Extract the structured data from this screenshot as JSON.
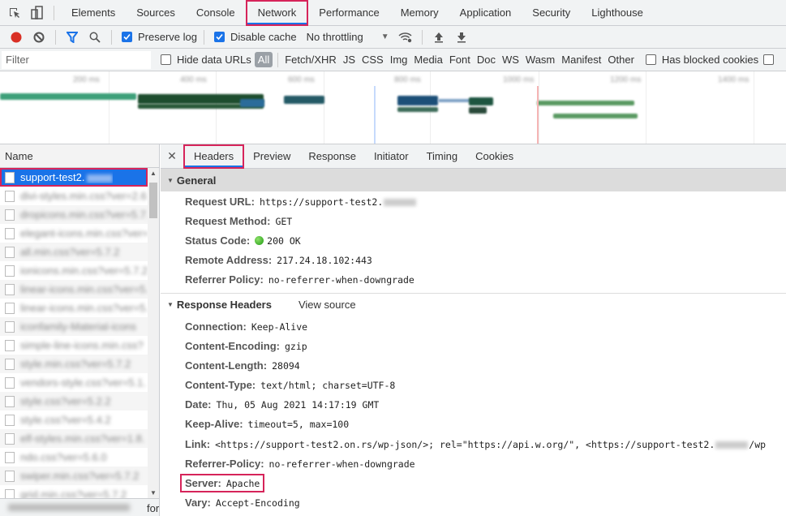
{
  "tabs": [
    "Elements",
    "Sources",
    "Console",
    "Network",
    "Performance",
    "Memory",
    "Application",
    "Security",
    "Lighthouse"
  ],
  "active_tab": "Network",
  "toolbar": {
    "preserve_log_label": "Preserve log",
    "preserve_log_checked": true,
    "disable_cache_label": "Disable cache",
    "disable_cache_checked": true,
    "throttling_value": "No throttling"
  },
  "filterbar": {
    "filter_placeholder": "Filter",
    "hide_data_urls_label": "Hide data URLs",
    "all_label": "All",
    "types": [
      "Fetch/XHR",
      "JS",
      "CSS",
      "Img",
      "Media",
      "Font",
      "Doc",
      "WS",
      "Wasm",
      "Manifest",
      "Other"
    ],
    "has_blocked_cookies_label": "Has blocked cookies"
  },
  "overview": {
    "ticks": [
      "200 ms",
      "400 ms",
      "600 ms",
      "800 ms",
      "1000 ms",
      "1200 ms",
      "1400 ms"
    ]
  },
  "request_list": {
    "header": "Name",
    "selected": "support-test2.",
    "rows": [
      "divi-styles.min.css?ver=2.6",
      "dropicons.min.css?ver=5.7.2",
      "elegant-icons.min.css?ver=5.7",
      "all.min.css?ver=5.7.2",
      "ionicons.min.css?ver=5.7.2",
      "linear-icons.min.css?ver=5.",
      "linear-icons.min.css?ver=5.",
      "iconfamily-Material-icons",
      "simple-line-icons.min.css?",
      "style.min.css?ver=5.7.2",
      "vendors-style.css?ver=5.1.",
      "style.css?ver=5.2.2",
      "style.css?ver=5.4.2",
      "elf-styles.min.css?ver=1.8.",
      "ndo.css?ver=5.6.0",
      "swiper.min.css?ver=5.7.2",
      "grid.min.css?ver=5.7.2"
    ],
    "status_suffix": "for"
  },
  "details": {
    "tabs": [
      "Headers",
      "Preview",
      "Response",
      "Initiator",
      "Timing",
      "Cookies"
    ],
    "active_tab": "Headers",
    "general": {
      "title": "General",
      "items": [
        {
          "key": "Request URL:",
          "value": "https://support-test2."
        },
        {
          "key": "Request Method:",
          "value": "GET"
        },
        {
          "key": "Status Code:",
          "value": "200 OK"
        },
        {
          "key": "Remote Address:",
          "value": "217.24.18.102:443"
        },
        {
          "key": "Referrer Policy:",
          "value": "no-referrer-when-downgrade"
        }
      ]
    },
    "response_headers": {
      "title": "Response Headers",
      "view_source": "View source",
      "items": [
        {
          "key": "Connection:",
          "value": "Keep-Alive"
        },
        {
          "key": "Content-Encoding:",
          "value": "gzip"
        },
        {
          "key": "Content-Length:",
          "value": "28094"
        },
        {
          "key": "Content-Type:",
          "value": "text/html; charset=UTF-8"
        },
        {
          "key": "Date:",
          "value": "Thu, 05 Aug 2021 14:17:19 GMT"
        },
        {
          "key": "Keep-Alive:",
          "value": "timeout=5, max=100"
        },
        {
          "key": "Link:",
          "value": "<https://support-test2.on.rs/wp-json/>; rel=\"https://api.w.org/\", <https://support-test2.",
          "value_tail": "/wp"
        },
        {
          "key": "Referrer-Policy:",
          "value": "no-referrer-when-downgrade"
        },
        {
          "key": "Server:",
          "value": "Apache"
        },
        {
          "key": "Vary:",
          "value": "Accept-Encoding"
        }
      ]
    }
  },
  "colors": {
    "accent": "#1a73e8",
    "highlight": "#d6245a",
    "record": "#d93025",
    "status_ok": "#1f9b12"
  }
}
